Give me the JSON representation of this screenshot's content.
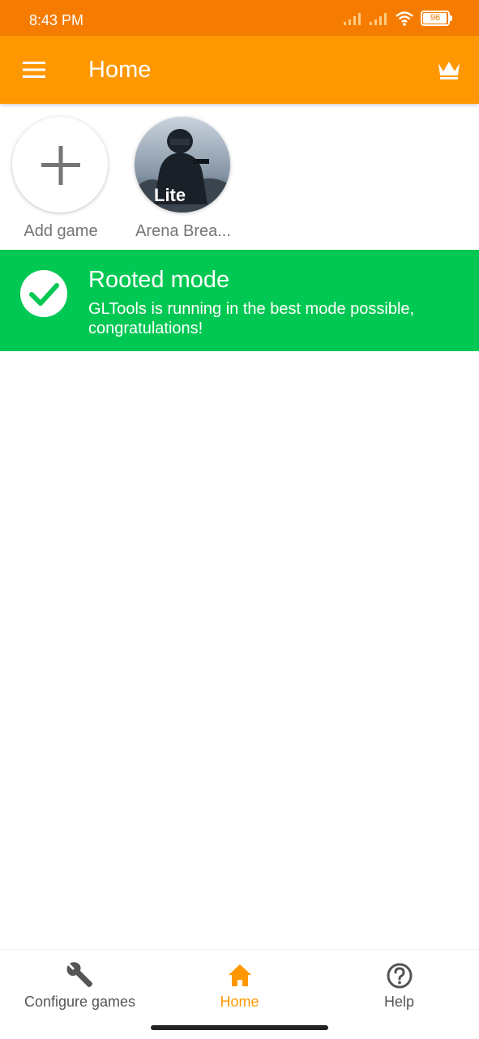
{
  "status_bar": {
    "time": "8:43 PM",
    "battery_level": "96",
    "signal_icon": "signal-icon",
    "wifi_icon": "wifi-icon",
    "battery_icon": "battery-icon"
  },
  "app_bar": {
    "title": "Home",
    "menu_icon": "hamburger-menu-icon",
    "premium_icon": "crown-icon"
  },
  "games": [
    {
      "label": "Add game",
      "icon": "plus-icon"
    },
    {
      "label": "Arena Brea...",
      "icon": "game-thumbnail",
      "badge": "Lite"
    }
  ],
  "banner": {
    "title": "Rooted mode",
    "description": "GLTools is running in the best mode possible, congratulations!",
    "icon": "check-circle-icon"
  },
  "bottom_nav": {
    "items": [
      {
        "label": "Configure games",
        "icon": "wrench-icon",
        "active": false
      },
      {
        "label": "Home",
        "icon": "home-icon",
        "active": true
      },
      {
        "label": "Help",
        "icon": "help-circle-icon",
        "active": false
      }
    ]
  },
  "colors": {
    "status_bar": "#f57c00",
    "app_bar": "#ff9800",
    "banner": "#00c853",
    "active_nav": "#ff9800",
    "inactive_nav": "#555555"
  }
}
